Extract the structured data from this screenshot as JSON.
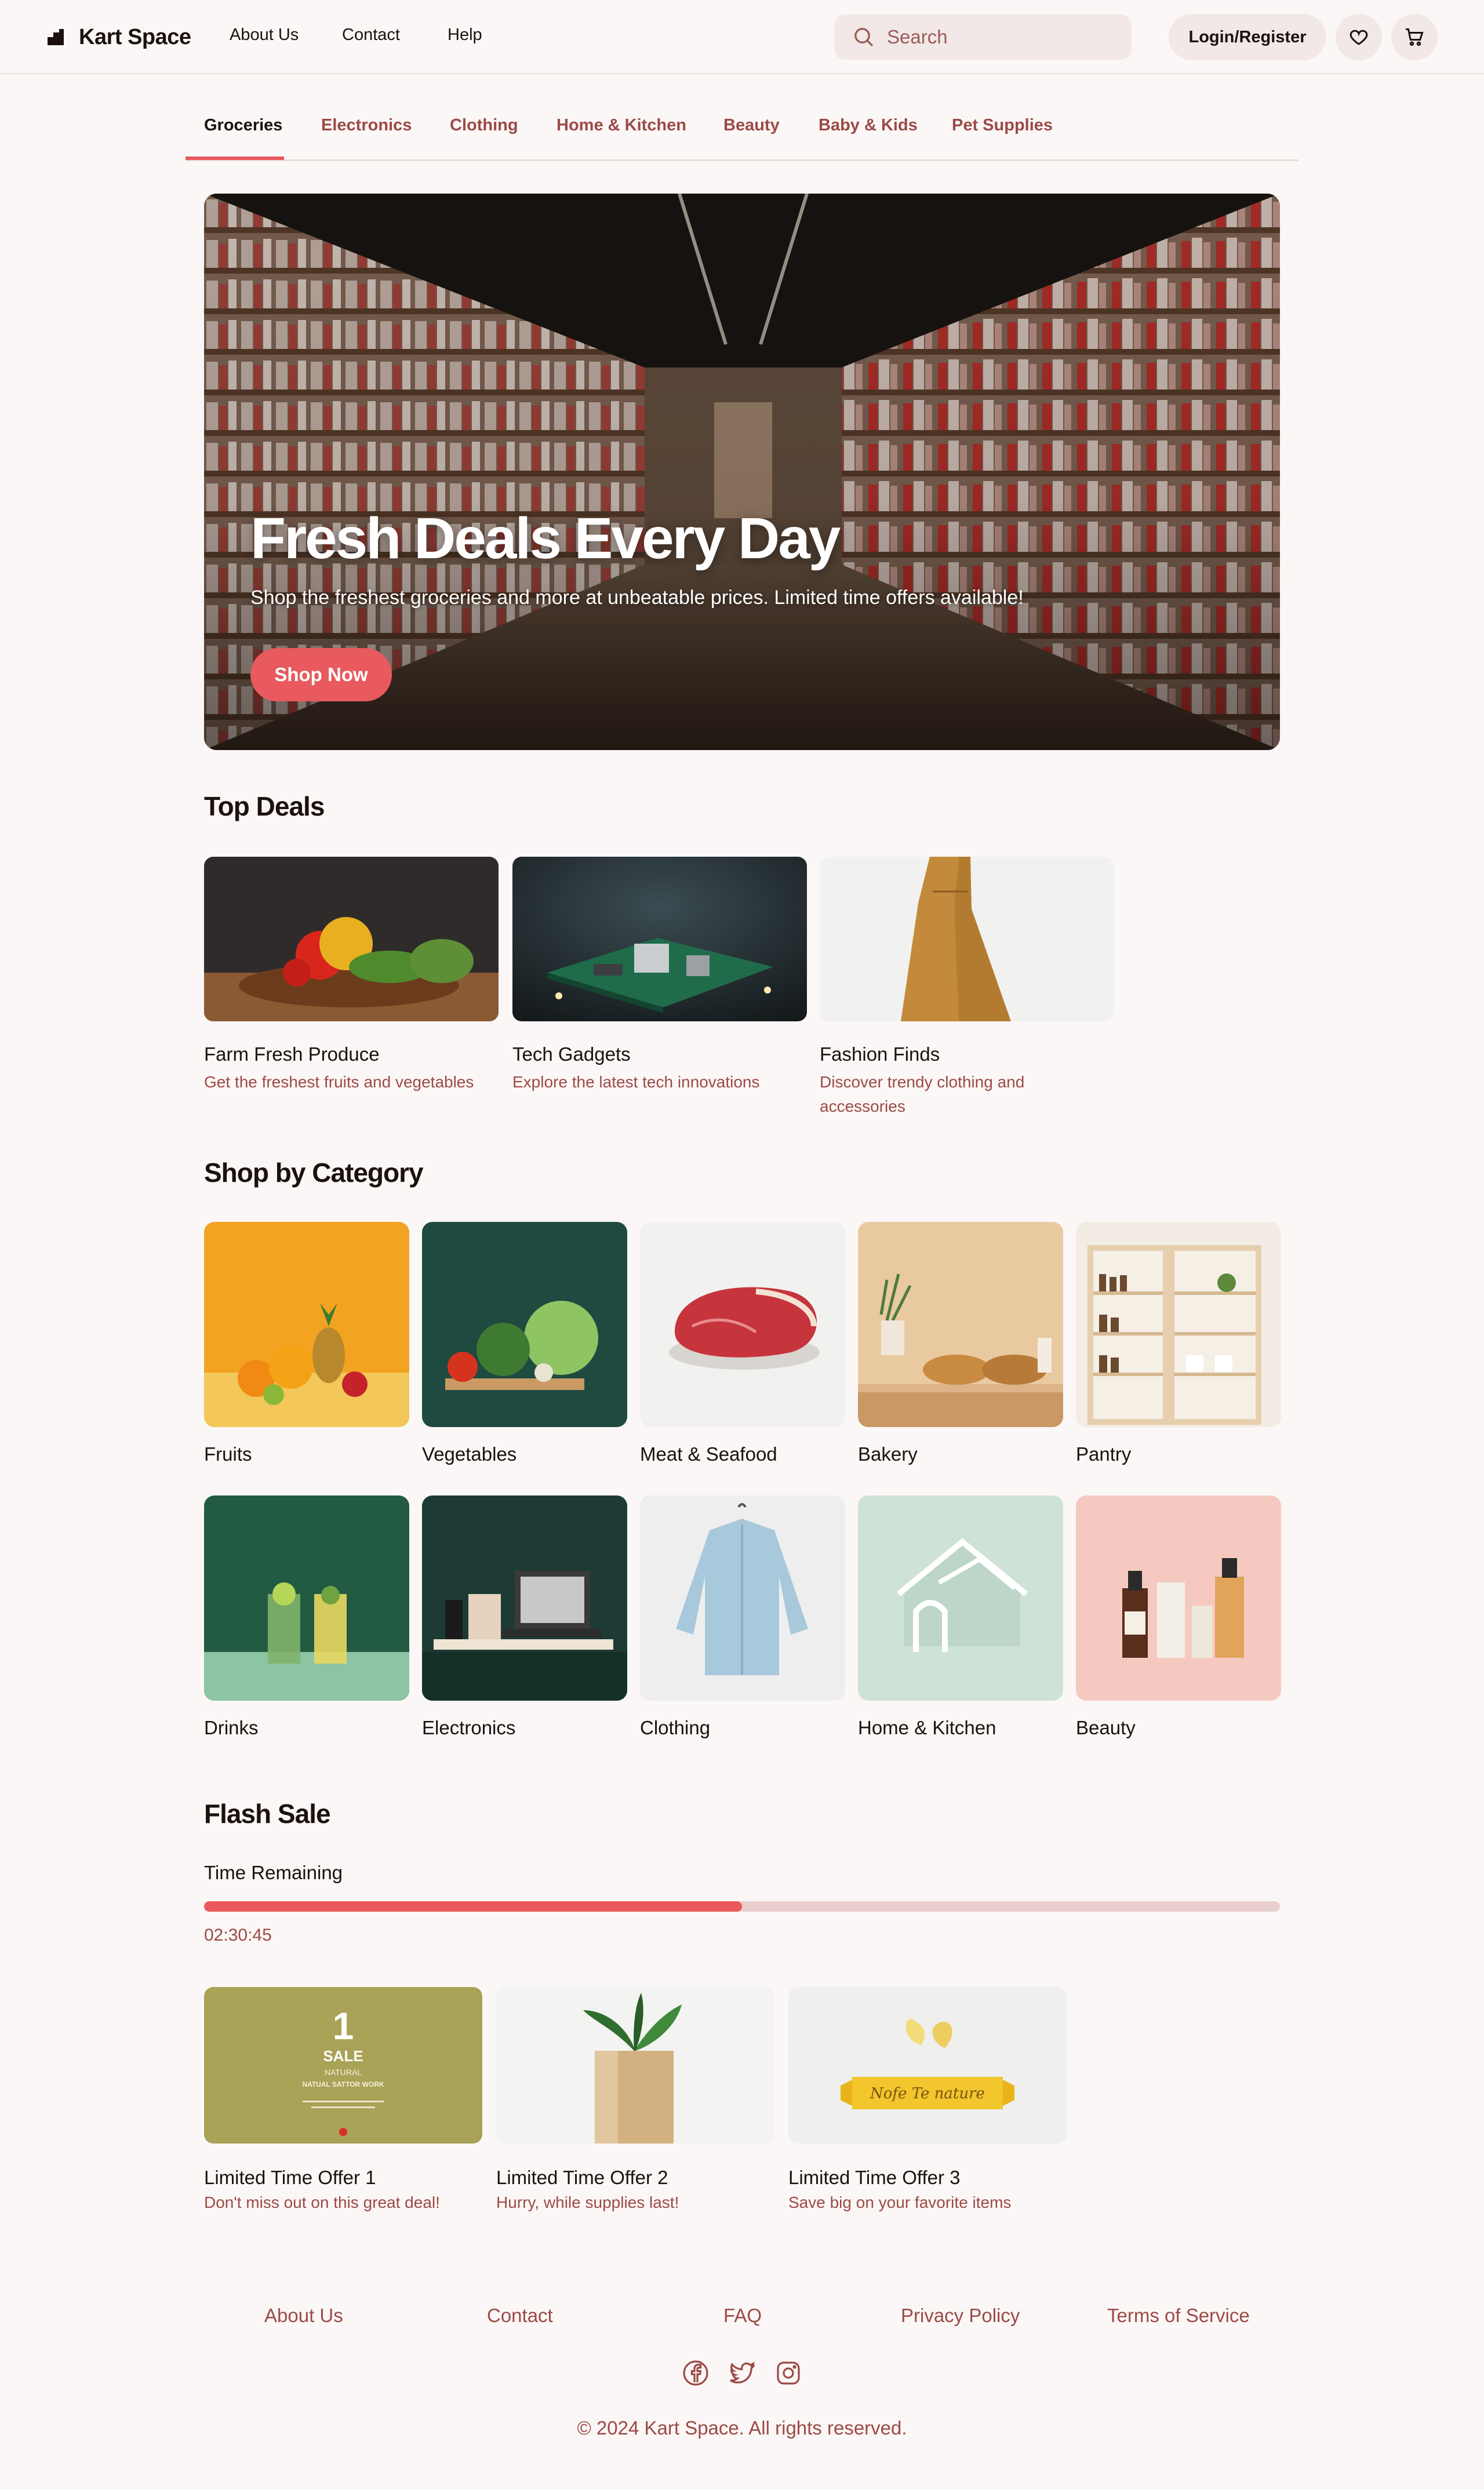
{
  "header": {
    "brand": "Kart Space",
    "nav": [
      "About Us",
      "Contact",
      "Help"
    ],
    "search_placeholder": "Search",
    "login_label": "Login/Register"
  },
  "tabs": [
    "Groceries",
    "Electronics",
    "Clothing",
    "Home & Kitchen",
    "Beauty",
    "Baby & Kids",
    "Pet Supplies"
  ],
  "active_tab": "Groceries",
  "hero": {
    "title": "Fresh Deals Every Day",
    "subtitle": "Shop the freshest groceries and more at unbeatable prices. Limited time offers available!",
    "cta": "Shop Now"
  },
  "top_deals": {
    "title": "Top Deals",
    "items": [
      {
        "title": "Farm Fresh Produce",
        "desc": "Get the freshest fruits and vegetables"
      },
      {
        "title": "Tech Gadgets",
        "desc": "Explore the latest tech innovations"
      },
      {
        "title": "Fashion Finds",
        "desc": "Discover trendy clothing and accessories"
      }
    ]
  },
  "categories": {
    "title": "Shop by Category",
    "items": [
      "Fruits",
      "Vegetables",
      "Meat & Seafood",
      "Bakery",
      "Pantry",
      "Drinks",
      "Electronics",
      "Clothing",
      "Home & Kitchen",
      "Beauty"
    ]
  },
  "flash_sale": {
    "title": "Flash Sale",
    "time_label": "Time Remaining",
    "progress_fraction": 0.5,
    "time_value": "02:30:45",
    "offers": [
      {
        "title": "Limited Time Offer 1",
        "desc": "Don't miss out on this great deal!"
      },
      {
        "title": "Limited Time Offer 2",
        "desc": "Hurry, while supplies last!"
      },
      {
        "title": "Limited Time Offer 3",
        "desc": "Save big on your favorite items"
      }
    ],
    "offer1_image_text": {
      "big": "1",
      "line1": "SALE",
      "line2": "NATURAL",
      "line3": "NATUAL SATTOR WORK"
    },
    "offer3_image_text": "Nofe Te nature"
  },
  "footer": {
    "links": [
      "About Us",
      "Contact",
      "FAQ",
      "Privacy Policy",
      "Terms of Service"
    ],
    "social_icons": [
      "facebook-icon",
      "twitter-icon",
      "instagram-icon"
    ],
    "copyright": "© 2024 Kart Space. All rights reserved."
  },
  "colors": {
    "accent": "#e8585c",
    "link": "#9b4a46",
    "background": "#fbf7f6",
    "surface": "#f1e8e7",
    "text": "#1b1110"
  }
}
